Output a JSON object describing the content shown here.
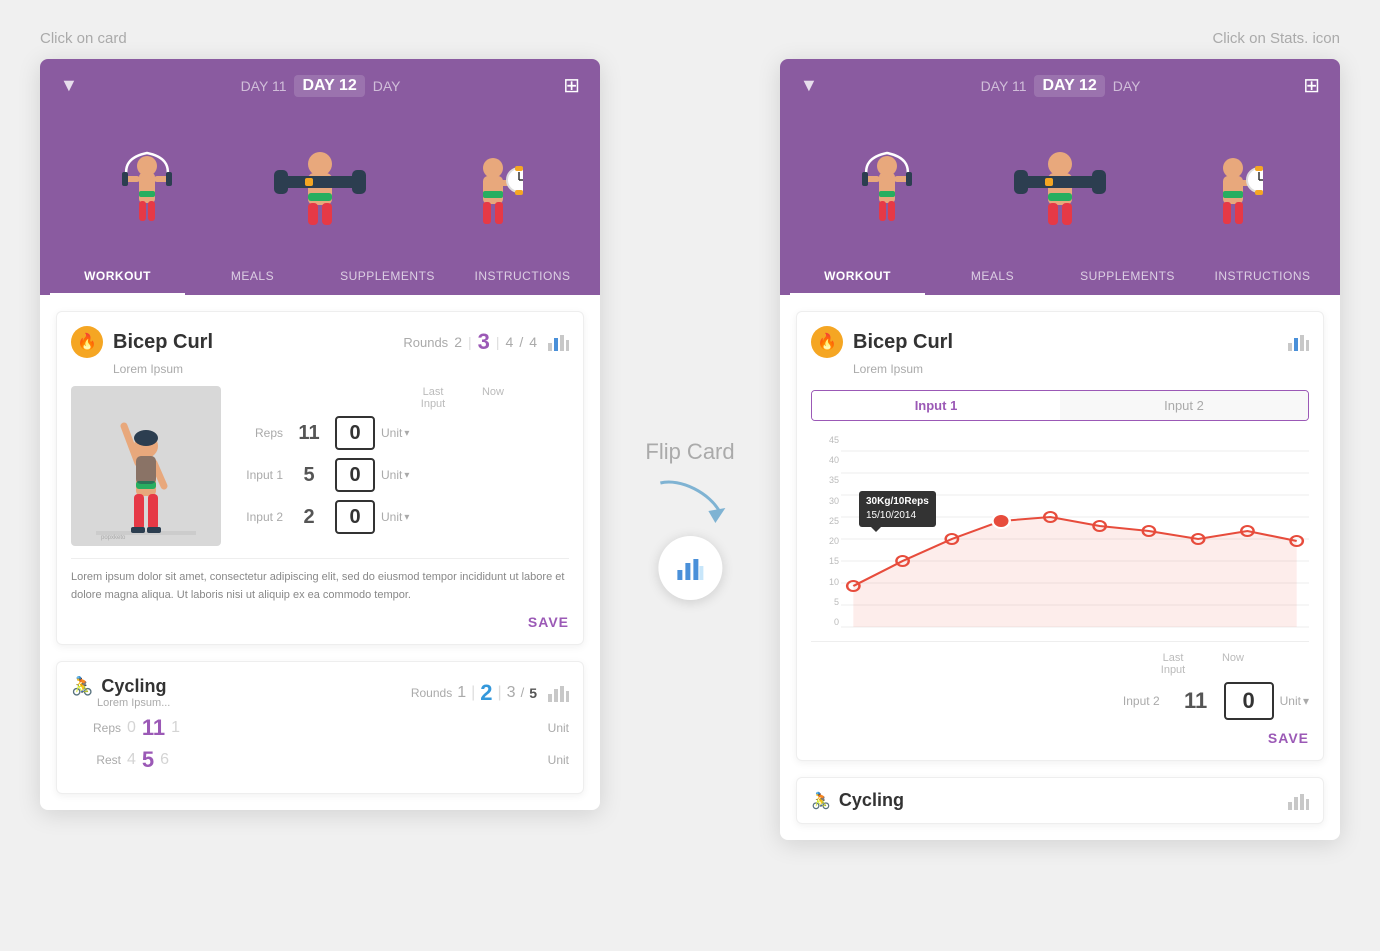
{
  "instructions": {
    "left_label": "Click on card",
    "right_label": "Click on Stats. icon",
    "flip_card_label": "Flip Card"
  },
  "header": {
    "day_prev": "DAY 11",
    "day_active": "DAY 12",
    "day_next": "DAY",
    "tab_workout": "WORKOUT",
    "tab_meals": "MEALS",
    "tab_supplements": "SUPPLEMENTS",
    "tab_instructions": "INSTRUCTIONS"
  },
  "bicep_curl": {
    "title": "Bicep Curl",
    "subtitle": "Lorem Ipsum",
    "rounds_label": "Rounds",
    "rounds_prev": "2",
    "rounds_current": "3",
    "rounds_next": "4",
    "rounds_total": "4",
    "last_input_label": "Last Input",
    "now_label": "Now",
    "reps_label": "Reps",
    "reps_last": "11",
    "reps_now": "0",
    "reps_unit": "Unit",
    "input1_label": "Input 1",
    "input1_last": "5",
    "input1_now": "0",
    "input1_unit": "Unit",
    "input2_label": "Input 2",
    "input2_last": "2",
    "input2_now": "0",
    "input2_unit": "Unit",
    "description": "Lorem ipsum dolor sit amet, consectetur adipiscing elit, sed do eiusmod tempor incididunt ut labore et dolore magna aliqua. Ut laboris nisi ut aliquip ex ea commodo tempor.",
    "save_label": "SAVE"
  },
  "cycling": {
    "title": "Cycling",
    "subtitle": "Lorem Ipsum...",
    "rounds_label": "Rounds",
    "rounds_prev": "1",
    "rounds_current": "2",
    "rounds_next": "3",
    "rounds_total": "5",
    "reps_label": "Reps",
    "reps_prev": "0",
    "reps_current": "11",
    "reps_next": "1",
    "reps_unit": "Unit",
    "rest_label": "Rest",
    "rest_prev": "4",
    "rest_current": "5",
    "rest_next": "6",
    "rest_unit": "Unit"
  },
  "stats_view": {
    "tab1": "Input 1",
    "tab2": "Input 2",
    "chart": {
      "y_labels": [
        "45",
        "40",
        "35",
        "30",
        "25",
        "20",
        "15",
        "10",
        "5",
        "0"
      ],
      "tooltip_kg": "30Kg",
      "tooltip_reps": "10Reps",
      "tooltip_date": "15/10/2014"
    },
    "last_input_label": "Last Input",
    "now_label": "Now",
    "input2_label": "Input 2",
    "input2_last": "11",
    "input2_now": "0",
    "input2_unit": "Unit",
    "save_label": "SAVE"
  },
  "right_second_card": {
    "title": "Cycling"
  },
  "colors": {
    "purple": "#8A5BA0",
    "purple_accent": "#9B59B6",
    "blue_accent": "#3498DB",
    "orange": "#f5a623"
  }
}
